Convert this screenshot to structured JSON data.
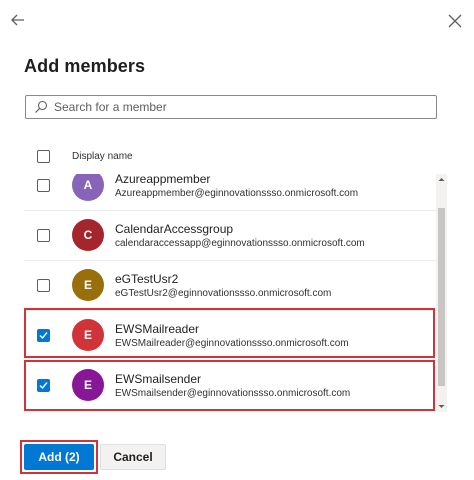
{
  "header": {
    "back_icon": "arrow-left-icon",
    "close_icon": "close-icon"
  },
  "title": "Add members",
  "search": {
    "placeholder": "Search for a member",
    "value": "",
    "icon": "search-icon"
  },
  "list": {
    "column_header": "Display name",
    "select_all_checked": false,
    "members": [
      {
        "initial": "A",
        "name": "Azureappmember",
        "email": "Azureappmember@eginnovationssso.onmicrosoft.com",
        "color": "#8764b8",
        "checked": false
      },
      {
        "initial": "C",
        "name": "CalendarAccessgroup",
        "email": "calendaraccessapp@eginnovationssso.onmicrosoft.com",
        "color": "#a4262c",
        "checked": false
      },
      {
        "initial": "E",
        "name": "eGTestUsr2",
        "email": "eGTestUsr2@eginnovationssso.onmicrosoft.com",
        "color": "#986f0b",
        "checked": false
      },
      {
        "initial": "E",
        "name": "EWSMailreader",
        "email": "EWSMailreader@eginnovationssso.onmicrosoft.com",
        "color": "#d13438",
        "checked": true
      },
      {
        "initial": "E",
        "name": "EWSmailsender",
        "email": "EWSmailsender@eginnovationssso.onmicrosoft.com",
        "color": "#881798",
        "checked": true
      }
    ]
  },
  "footer": {
    "add_label": "Add (2)",
    "cancel_label": "Cancel"
  },
  "colors": {
    "primary": "#0078d4",
    "highlight": "#d13438"
  }
}
